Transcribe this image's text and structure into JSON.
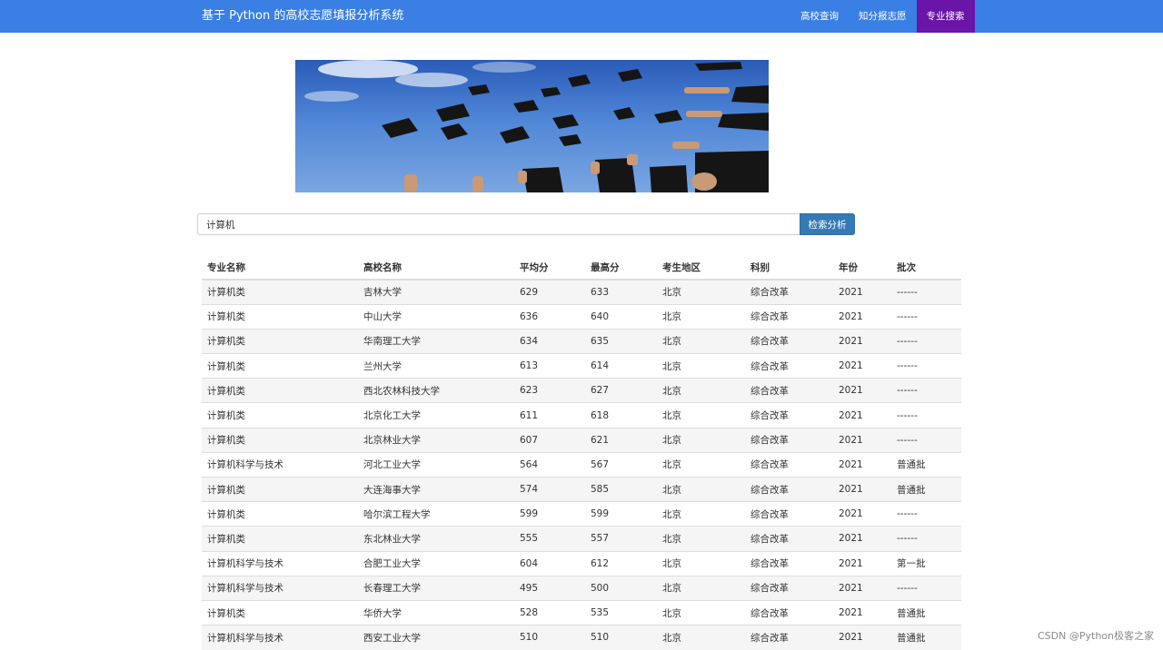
{
  "navbar": {
    "brand": "基于 Python 的高校志愿填报分析系统",
    "items": [
      {
        "label": "高校查询",
        "active": false
      },
      {
        "label": "知分报志愿",
        "active": false
      },
      {
        "label": "专业搜索",
        "active": true
      }
    ]
  },
  "banner": {
    "image": "graduation-caps-photo"
  },
  "search": {
    "value": "计算机",
    "button_label": "检索分析"
  },
  "table": {
    "headers": [
      "专业名称",
      "高校名称",
      "平均分",
      "最高分",
      "考生地区",
      "科别",
      "年份",
      "批次"
    ],
    "rows": [
      [
        "计算机类",
        "吉林大学",
        "629",
        "633",
        "北京",
        "综合改革",
        "2021",
        "------"
      ],
      [
        "计算机类",
        "中山大学",
        "636",
        "640",
        "北京",
        "综合改革",
        "2021",
        "------"
      ],
      [
        "计算机类",
        "华南理工大学",
        "634",
        "635",
        "北京",
        "综合改革",
        "2021",
        "------"
      ],
      [
        "计算机类",
        "兰州大学",
        "613",
        "614",
        "北京",
        "综合改革",
        "2021",
        "------"
      ],
      [
        "计算机类",
        "西北农林科技大学",
        "623",
        "627",
        "北京",
        "综合改革",
        "2021",
        "------"
      ],
      [
        "计算机类",
        "北京化工大学",
        "611",
        "618",
        "北京",
        "综合改革",
        "2021",
        "------"
      ],
      [
        "计算机类",
        "北京林业大学",
        "607",
        "621",
        "北京",
        "综合改革",
        "2021",
        "------"
      ],
      [
        "计算机科学与技术",
        "河北工业大学",
        "564",
        "567",
        "北京",
        "综合改革",
        "2021",
        "普通批"
      ],
      [
        "计算机类",
        "大连海事大学",
        "574",
        "585",
        "北京",
        "综合改革",
        "2021",
        "普通批"
      ],
      [
        "计算机类",
        "哈尔滨工程大学",
        "599",
        "599",
        "北京",
        "综合改革",
        "2021",
        "------"
      ],
      [
        "计算机类",
        "东北林业大学",
        "555",
        "557",
        "北京",
        "综合改革",
        "2021",
        "------"
      ],
      [
        "计算机科学与技术",
        "合肥工业大学",
        "604",
        "612",
        "北京",
        "综合改革",
        "2021",
        "第一批"
      ],
      [
        "计算机科学与技术",
        "长春理工大学",
        "495",
        "500",
        "北京",
        "综合改革",
        "2021",
        "------"
      ],
      [
        "计算机类",
        "华侨大学",
        "528",
        "535",
        "北京",
        "综合改革",
        "2021",
        "普通批"
      ],
      [
        "计算机科学与技术",
        "西安工业大学",
        "510",
        "510",
        "北京",
        "综合改革",
        "2021",
        "普通批"
      ]
    ]
  },
  "watermark": "CSDN @Python极客之家",
  "colors": {
    "navbar": "#3a7fe3",
    "nav_active": "#6a14a8",
    "link": "#337ab7",
    "button": "#337ab7"
  }
}
